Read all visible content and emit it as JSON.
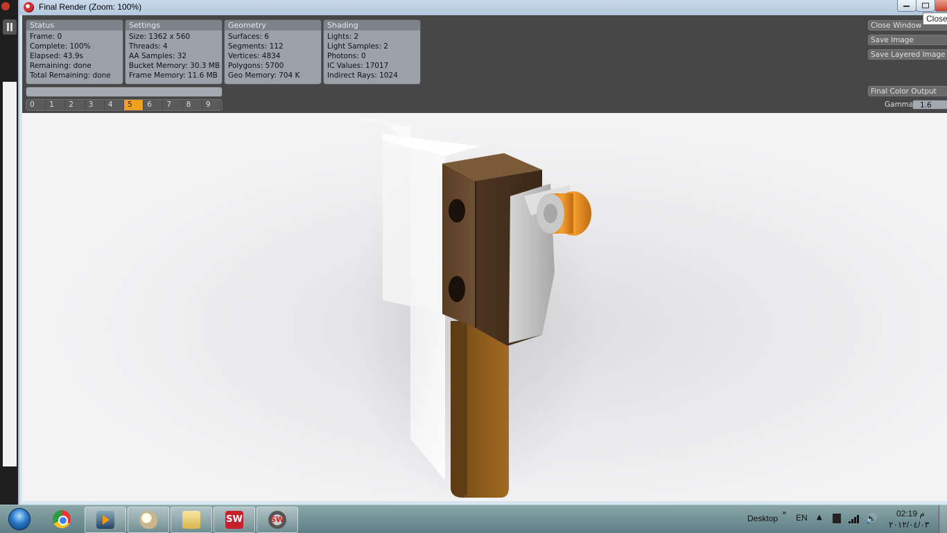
{
  "window": {
    "title": "Final Render (Zoom: 100%)",
    "tooltip": "Close"
  },
  "panels": [
    {
      "title": "Status",
      "lines": [
        "Frame: 0",
        "Complete: 100%",
        "Elapsed: 43.9s",
        "Remaining: done",
        "Total Remaining: done"
      ]
    },
    {
      "title": "Settings",
      "lines": [
        "Size: 1362 x 560",
        "Threads: 4",
        "AA Samples: 32",
        "Bucket Memory: 30.3 MB",
        "Frame Memory: 11.6 MB"
      ]
    },
    {
      "title": "Geometry",
      "lines": [
        "Surfaces: 6",
        "Segments: 112",
        "Vertices: 4834",
        "Polygons: 5700",
        "Geo Memory: 704 K"
      ]
    },
    {
      "title": "Shading",
      "lines": [
        "Lights: 2",
        "Light Samples: 2",
        "Photons: 0",
        "IC Values: 17017",
        "Indirect Rays: 1024"
      ]
    }
  ],
  "progress": 1.0,
  "buckets": {
    "items": [
      "0",
      "1",
      "2",
      "3",
      "4",
      "5",
      "6",
      "7",
      "8",
      "9"
    ],
    "active": "5"
  },
  "actions": {
    "close_window": "Close Window",
    "save_image": "Save Image",
    "save_layered_image": "Save Layered Image",
    "final_color_output": "Final Color Output"
  },
  "gamma": {
    "label": "Gamma",
    "value": "1.6"
  },
  "taskbar": {
    "apps": [
      "start-icon",
      "chrome-icon",
      "media-player-icon",
      "paint-icon",
      "explorer-icon",
      "solidworks-icon",
      "solidworks-render-icon"
    ],
    "desktop_label": "Desktop",
    "language": "EN",
    "time": "02:19 م",
    "date": "٢٠١٢/٠٤/٠٣"
  },
  "colors": {
    "panel_bg": "#474747",
    "accent": "#f0a020",
    "bronze": "#6b4a2c",
    "orange_roller": "#e8901a"
  }
}
